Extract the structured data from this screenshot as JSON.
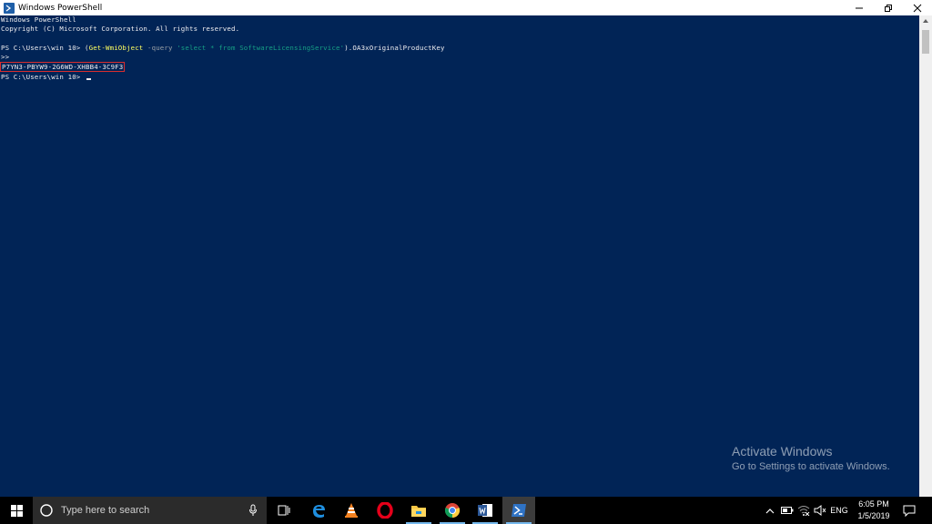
{
  "window": {
    "title": "Windows PowerShell"
  },
  "console": {
    "banner1": "Windows PowerShell",
    "banner2": "Copyright (C) Microsoft Corporation. All rights reserved.",
    "prompt": "PS C:\\Users\\win 10> ",
    "cmd_open": "(",
    "cmdlet": "Get-WmiObject",
    "param": " -query ",
    "query": "'select * from SoftwareLicensingService'",
    "cmd_close": ").OA3xOriginalProductKey",
    "continuation": ">>",
    "product_key": "P7YN3-PBYW9-2G6WD-XHBB4-3C9F3",
    "prompt2": "PS C:\\Users\\win 10> "
  },
  "watermark": {
    "heading": "Activate Windows",
    "sub": "Go to Settings to activate Windows."
  },
  "taskbar": {
    "search_placeholder": "Type here to search",
    "apps": [
      "start-icon",
      "search-icon",
      "microphone-icon",
      "task-view-icon",
      "edge-icon",
      "vlc-icon",
      "opera-icon",
      "file-explorer-icon",
      "chrome-icon",
      "word-icon",
      "powershell-icon"
    ],
    "language": "ENG",
    "time": "6:05 PM",
    "date": "1/5/2019"
  },
  "colors": {
    "console_bg": "#012456",
    "key_highlight": "#d92e2e",
    "cmdlet": "#ffff60"
  }
}
